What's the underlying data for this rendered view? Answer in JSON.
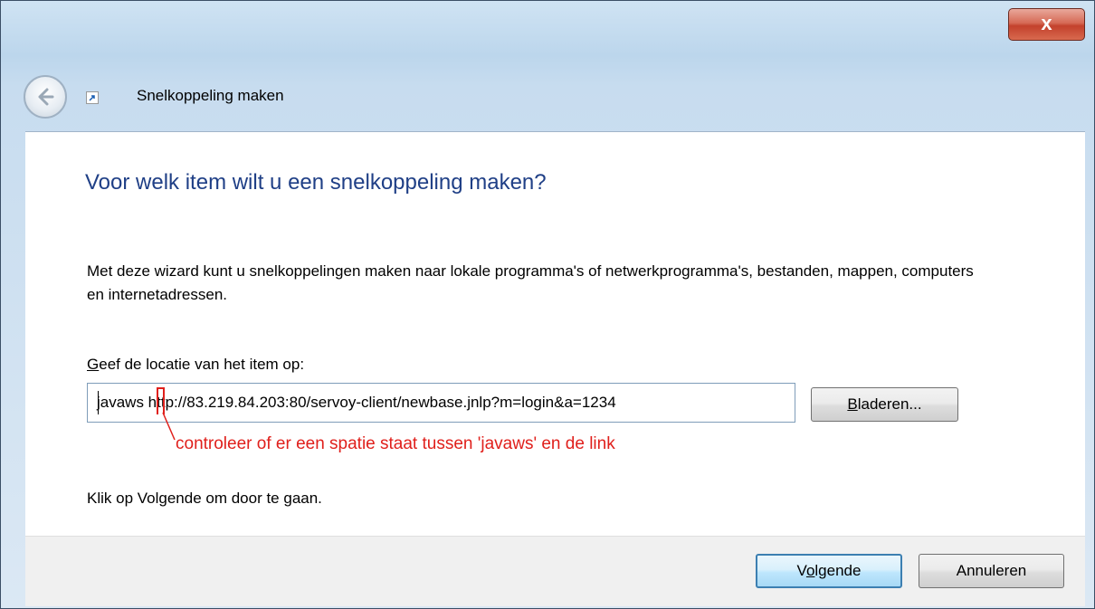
{
  "window": {
    "close_glyph": "x",
    "title": "Snelkoppeling maken"
  },
  "content": {
    "heading": "Voor welk item wilt u een snelkoppeling maken?",
    "description": "Met deze wizard kunt u snelkoppelingen maken naar lokale programma's of netwerkprogramma's, bestanden, mappen, computers en internetadressen.",
    "location_label_hotkey": "G",
    "location_label_rest": "eef de locatie van het item op:",
    "location_value": "javaws http://83.219.84.203:80/servoy-client/newbase.jnlp?m=login&a=1234",
    "browse_hotkey": "B",
    "browse_rest": "laderen...",
    "annotation": "controleer of er een spatie staat tussen 'javaws' en de link",
    "footer_text": "Klik op Volgende om door te gaan."
  },
  "buttons": {
    "next_pre": "V",
    "next_hotkey": "o",
    "next_post": "lgende",
    "cancel": "Annuleren"
  },
  "colors": {
    "heading": "#1f3f86",
    "annotation": "#e0201c",
    "close_button": "#c3412c"
  }
}
